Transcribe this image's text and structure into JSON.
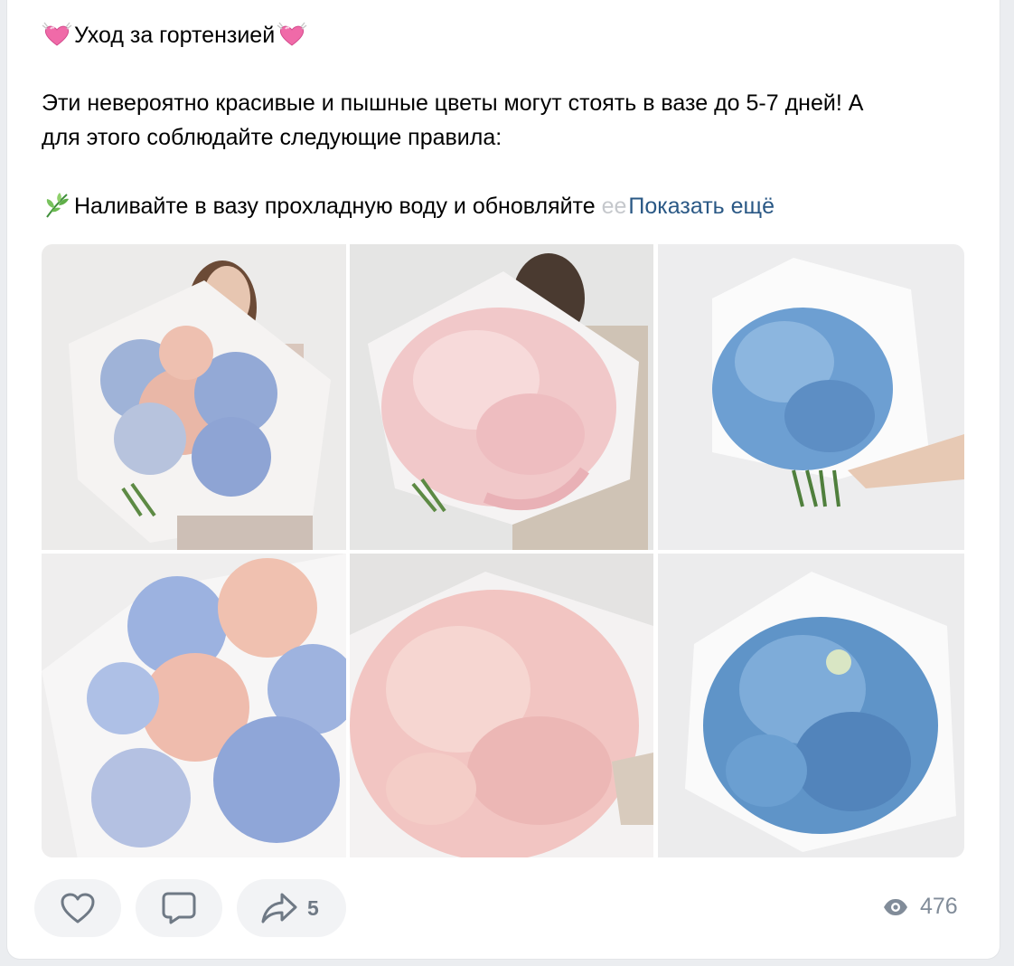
{
  "post": {
    "title": "Уход за гортензией",
    "paragraph_line1": "Эти невероятно красивые и пышные цветы могут стоять в вазе до 5-7 дней! А",
    "paragraph_line2": "для этого соблюдайте следующие правила:",
    "tip_visible": "Наливайте в вазу прохладную воду и обновляйте ",
    "tip_faded": "ее",
    "show_more": "Показать ещё",
    "emoji_title": "heart-with-ribbon",
    "emoji_tip": "herb"
  },
  "gallery": {
    "photos": [
      {
        "name": "photo-1",
        "description_icon": "woman-holding-mixed-hydrangea-bouquet"
      },
      {
        "name": "photo-2",
        "description_icon": "woman-holding-pink-hydrangea-bouquet"
      },
      {
        "name": "photo-3",
        "description_icon": "hand-holding-blue-hydrangea-bouquet"
      },
      {
        "name": "photo-4",
        "description_icon": "mixed-hydrangea-closeup"
      },
      {
        "name": "photo-5",
        "description_icon": "pink-hydrangea-closeup"
      },
      {
        "name": "photo-6",
        "description_icon": "blue-hydrangea-closeup"
      }
    ]
  },
  "actions": {
    "like_icon": "heart-icon",
    "comment_icon": "comment-icon",
    "share_icon": "share-icon",
    "share_count": "5",
    "views_icon": "eye-icon",
    "views_count": "476"
  },
  "colors": {
    "link": "#2a5885",
    "button_bg": "#f2f3f5",
    "icon": "#6f7985",
    "muted": "#818c99"
  }
}
